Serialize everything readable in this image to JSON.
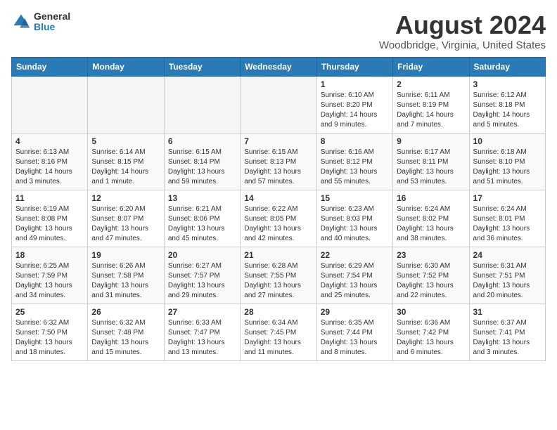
{
  "header": {
    "logo_general": "General",
    "logo_blue": "Blue",
    "month_title": "August 2024",
    "location": "Woodbridge, Virginia, United States"
  },
  "days_of_week": [
    "Sunday",
    "Monday",
    "Tuesday",
    "Wednesday",
    "Thursday",
    "Friday",
    "Saturday"
  ],
  "weeks": [
    [
      {
        "day": "",
        "detail": ""
      },
      {
        "day": "",
        "detail": ""
      },
      {
        "day": "",
        "detail": ""
      },
      {
        "day": "",
        "detail": ""
      },
      {
        "day": "1",
        "detail": "Sunrise: 6:10 AM\nSunset: 8:20 PM\nDaylight: 14 hours\nand 9 minutes."
      },
      {
        "day": "2",
        "detail": "Sunrise: 6:11 AM\nSunset: 8:19 PM\nDaylight: 14 hours\nand 7 minutes."
      },
      {
        "day": "3",
        "detail": "Sunrise: 6:12 AM\nSunset: 8:18 PM\nDaylight: 14 hours\nand 5 minutes."
      }
    ],
    [
      {
        "day": "4",
        "detail": "Sunrise: 6:13 AM\nSunset: 8:16 PM\nDaylight: 14 hours\nand 3 minutes."
      },
      {
        "day": "5",
        "detail": "Sunrise: 6:14 AM\nSunset: 8:15 PM\nDaylight: 14 hours\nand 1 minute."
      },
      {
        "day": "6",
        "detail": "Sunrise: 6:15 AM\nSunset: 8:14 PM\nDaylight: 13 hours\nand 59 minutes."
      },
      {
        "day": "7",
        "detail": "Sunrise: 6:15 AM\nSunset: 8:13 PM\nDaylight: 13 hours\nand 57 minutes."
      },
      {
        "day": "8",
        "detail": "Sunrise: 6:16 AM\nSunset: 8:12 PM\nDaylight: 13 hours\nand 55 minutes."
      },
      {
        "day": "9",
        "detail": "Sunrise: 6:17 AM\nSunset: 8:11 PM\nDaylight: 13 hours\nand 53 minutes."
      },
      {
        "day": "10",
        "detail": "Sunrise: 6:18 AM\nSunset: 8:10 PM\nDaylight: 13 hours\nand 51 minutes."
      }
    ],
    [
      {
        "day": "11",
        "detail": "Sunrise: 6:19 AM\nSunset: 8:08 PM\nDaylight: 13 hours\nand 49 minutes."
      },
      {
        "day": "12",
        "detail": "Sunrise: 6:20 AM\nSunset: 8:07 PM\nDaylight: 13 hours\nand 47 minutes."
      },
      {
        "day": "13",
        "detail": "Sunrise: 6:21 AM\nSunset: 8:06 PM\nDaylight: 13 hours\nand 45 minutes."
      },
      {
        "day": "14",
        "detail": "Sunrise: 6:22 AM\nSunset: 8:05 PM\nDaylight: 13 hours\nand 42 minutes."
      },
      {
        "day": "15",
        "detail": "Sunrise: 6:23 AM\nSunset: 8:03 PM\nDaylight: 13 hours\nand 40 minutes."
      },
      {
        "day": "16",
        "detail": "Sunrise: 6:24 AM\nSunset: 8:02 PM\nDaylight: 13 hours\nand 38 minutes."
      },
      {
        "day": "17",
        "detail": "Sunrise: 6:24 AM\nSunset: 8:01 PM\nDaylight: 13 hours\nand 36 minutes."
      }
    ],
    [
      {
        "day": "18",
        "detail": "Sunrise: 6:25 AM\nSunset: 7:59 PM\nDaylight: 13 hours\nand 34 minutes."
      },
      {
        "day": "19",
        "detail": "Sunrise: 6:26 AM\nSunset: 7:58 PM\nDaylight: 13 hours\nand 31 minutes."
      },
      {
        "day": "20",
        "detail": "Sunrise: 6:27 AM\nSunset: 7:57 PM\nDaylight: 13 hours\nand 29 minutes."
      },
      {
        "day": "21",
        "detail": "Sunrise: 6:28 AM\nSunset: 7:55 PM\nDaylight: 13 hours\nand 27 minutes."
      },
      {
        "day": "22",
        "detail": "Sunrise: 6:29 AM\nSunset: 7:54 PM\nDaylight: 13 hours\nand 25 minutes."
      },
      {
        "day": "23",
        "detail": "Sunrise: 6:30 AM\nSunset: 7:52 PM\nDaylight: 13 hours\nand 22 minutes."
      },
      {
        "day": "24",
        "detail": "Sunrise: 6:31 AM\nSunset: 7:51 PM\nDaylight: 13 hours\nand 20 minutes."
      }
    ],
    [
      {
        "day": "25",
        "detail": "Sunrise: 6:32 AM\nSunset: 7:50 PM\nDaylight: 13 hours\nand 18 minutes."
      },
      {
        "day": "26",
        "detail": "Sunrise: 6:32 AM\nSunset: 7:48 PM\nDaylight: 13 hours\nand 15 minutes."
      },
      {
        "day": "27",
        "detail": "Sunrise: 6:33 AM\nSunset: 7:47 PM\nDaylight: 13 hours\nand 13 minutes."
      },
      {
        "day": "28",
        "detail": "Sunrise: 6:34 AM\nSunset: 7:45 PM\nDaylight: 13 hours\nand 11 minutes."
      },
      {
        "day": "29",
        "detail": "Sunrise: 6:35 AM\nSunset: 7:44 PM\nDaylight: 13 hours\nand 8 minutes."
      },
      {
        "day": "30",
        "detail": "Sunrise: 6:36 AM\nSunset: 7:42 PM\nDaylight: 13 hours\nand 6 minutes."
      },
      {
        "day": "31",
        "detail": "Sunrise: 6:37 AM\nSunset: 7:41 PM\nDaylight: 13 hours\nand 3 minutes."
      }
    ]
  ]
}
